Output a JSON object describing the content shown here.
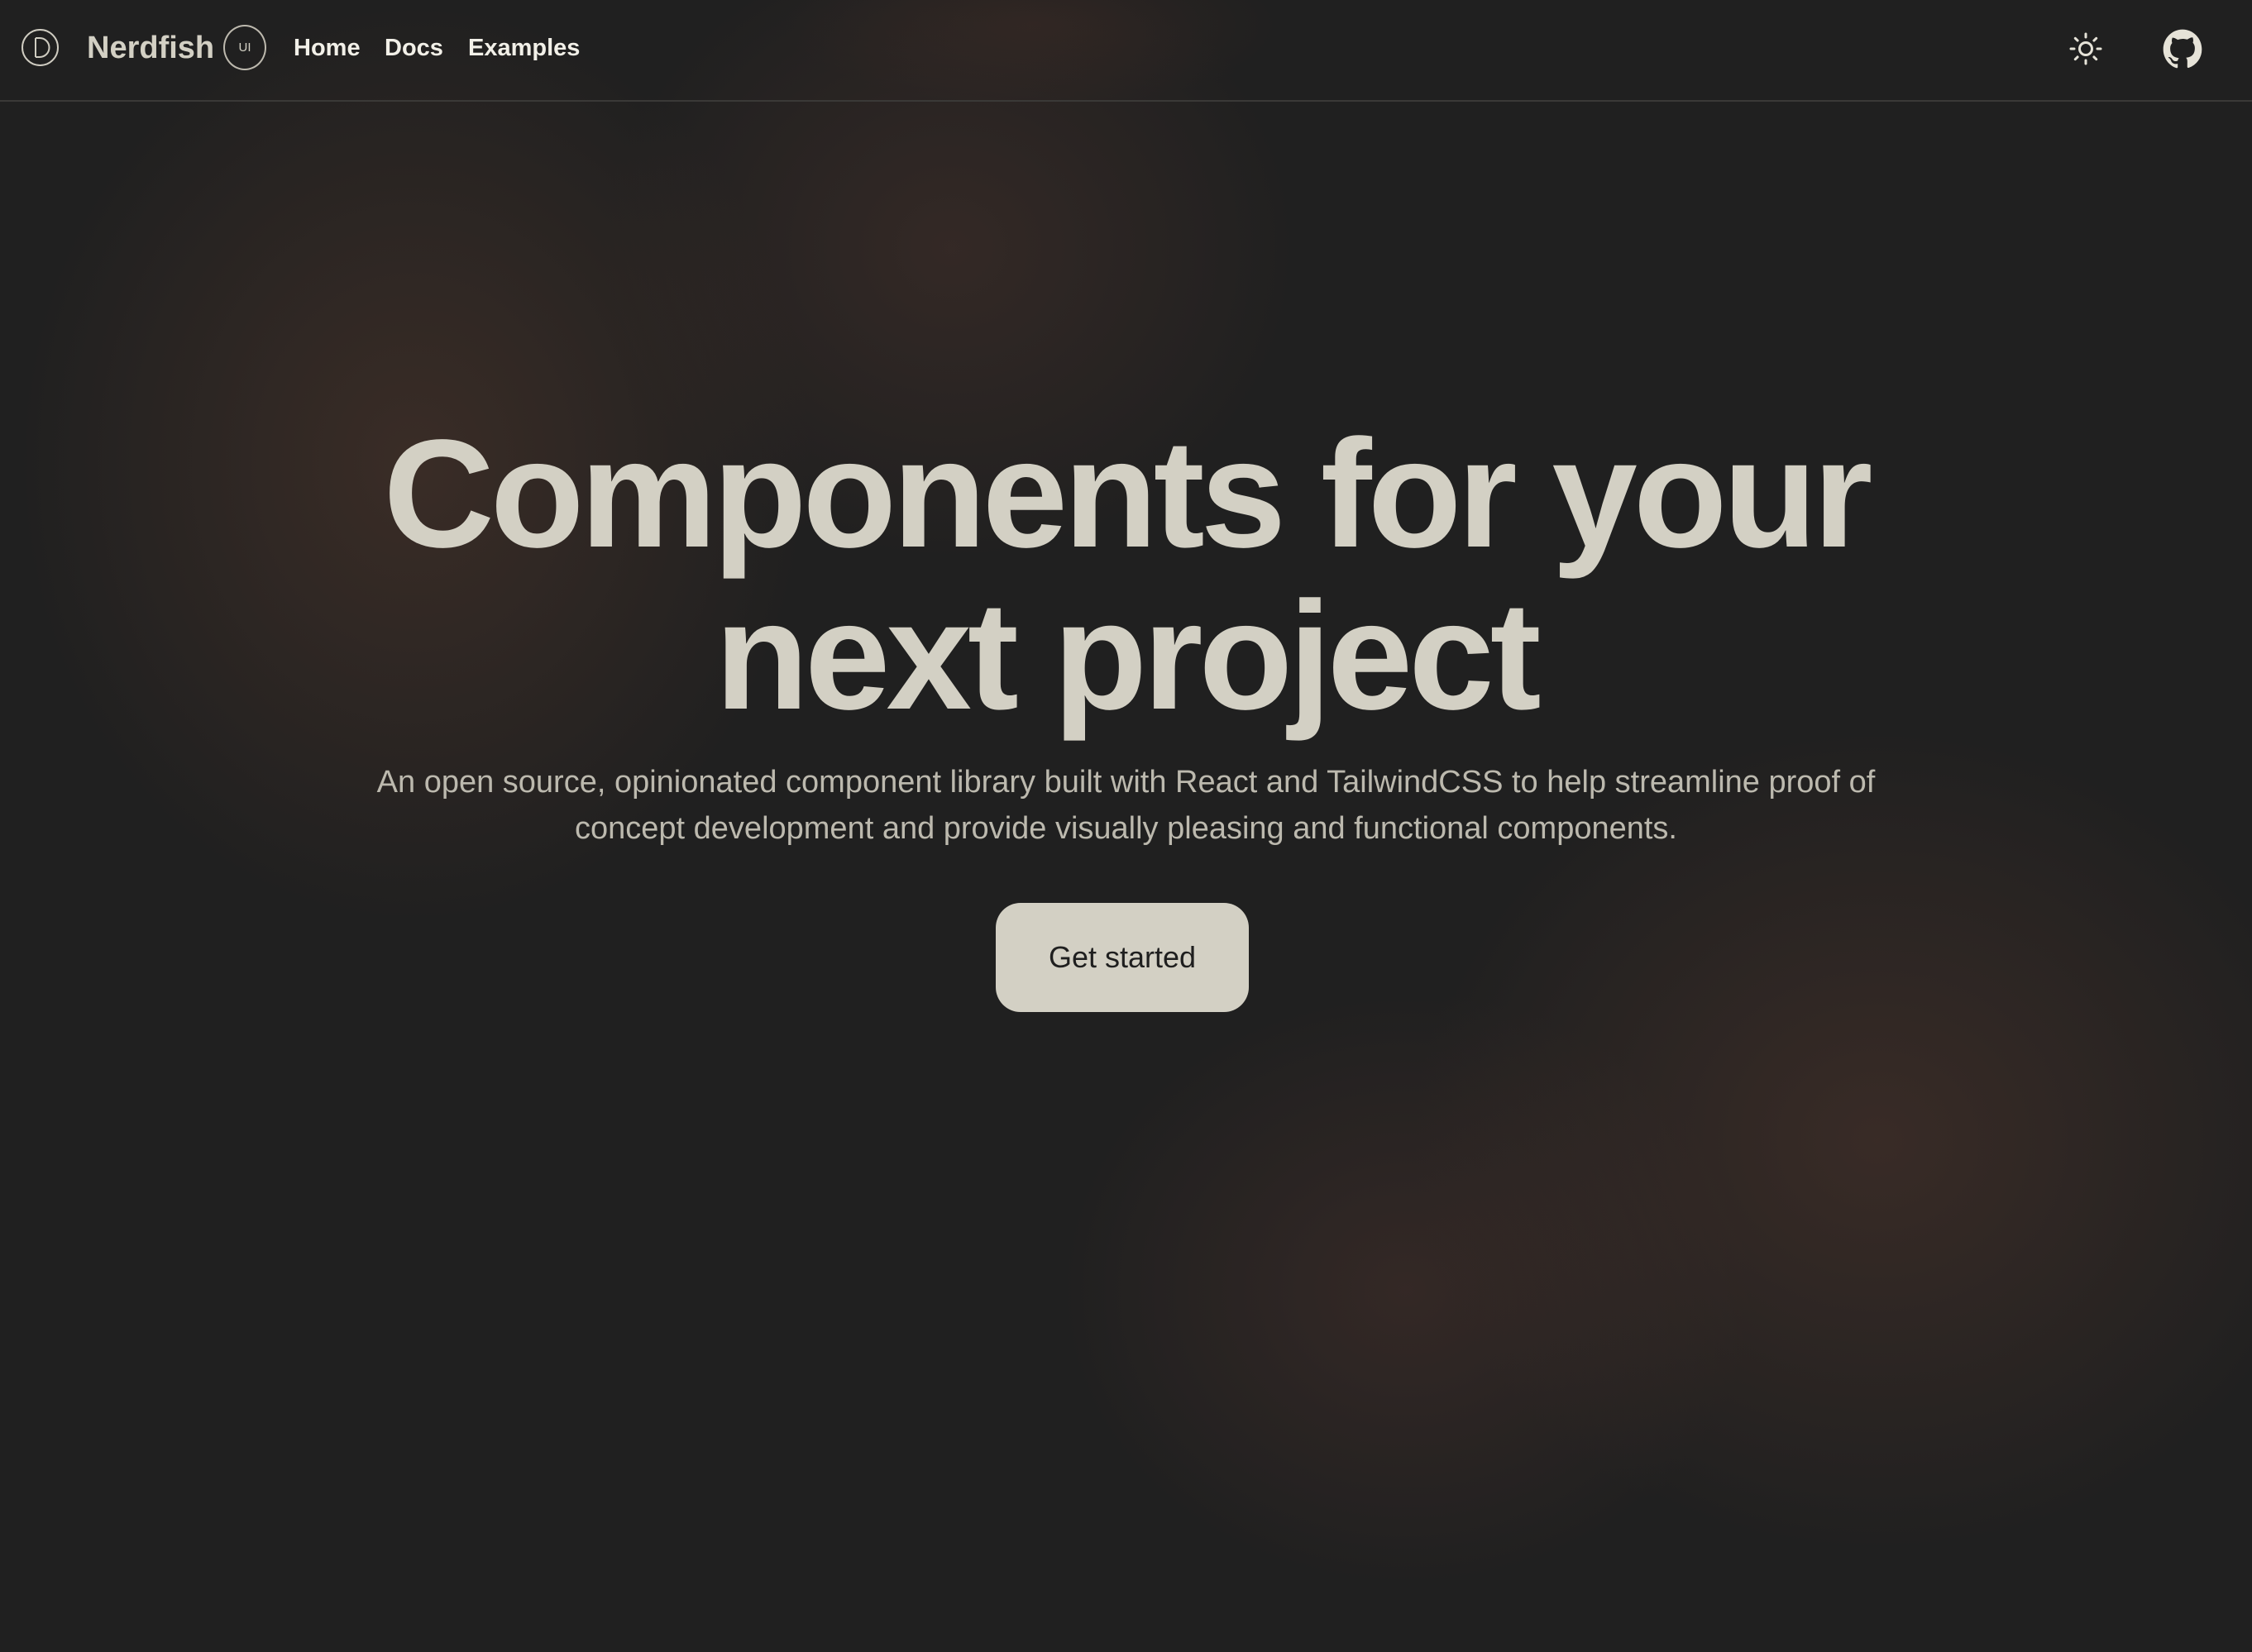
{
  "header": {
    "brand_name": "Nerdfish",
    "brand_badge": "UI",
    "logo_icon": "logo-d-icon",
    "nav": [
      {
        "label": "Home"
      },
      {
        "label": "Docs"
      },
      {
        "label": "Examples"
      }
    ],
    "theme_toggle_icon": "sun-icon",
    "github_icon": "github-icon"
  },
  "hero": {
    "title_line_1": "Components for your",
    "title_line_2": "next project",
    "subtitle_line_1": "An open source, opinionated component library built with React and TailwindCSS to help streamline proof of",
    "subtitle_line_2": "concept development and provide visually pleasing and functional components.",
    "cta_label": "Get started"
  },
  "colors": {
    "background": "#202020",
    "foreground": "#d3d0c4",
    "muted_text": "#bcb9ae",
    "glow": "#4a342a"
  }
}
